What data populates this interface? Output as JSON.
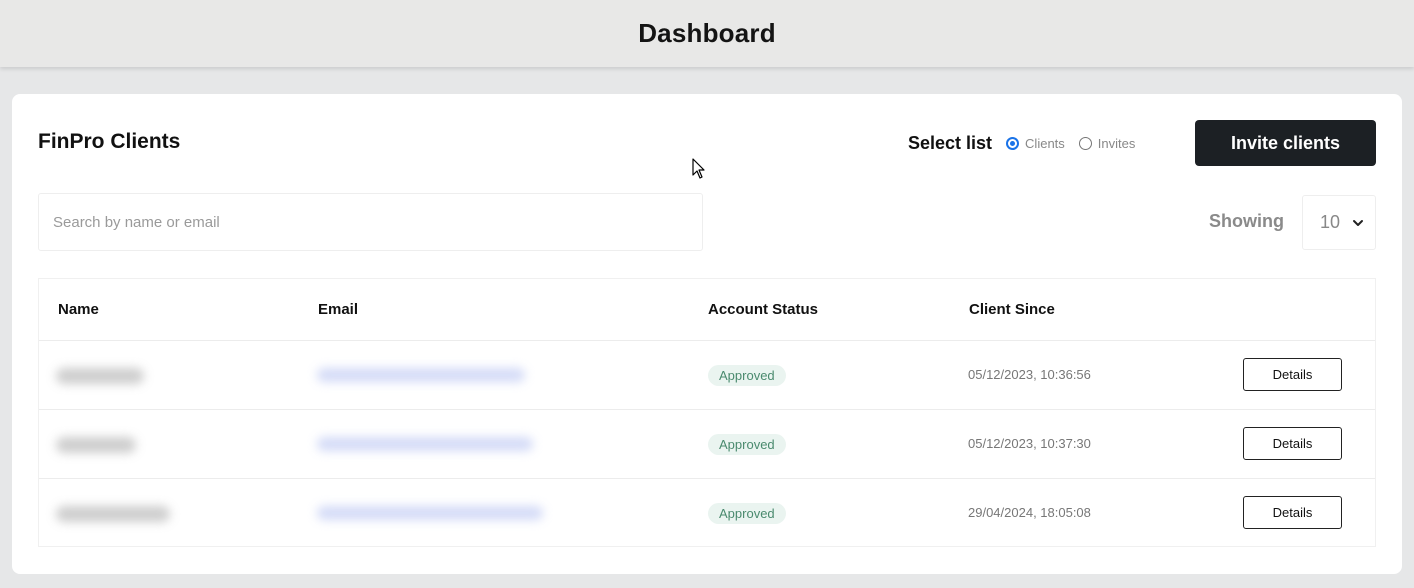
{
  "header": {
    "title": "Dashboard"
  },
  "card": {
    "title": "FinPro Clients",
    "select_list": {
      "label": "Select list",
      "options": [
        {
          "label": "Clients",
          "checked": true
        },
        {
          "label": "Invites",
          "checked": false
        }
      ]
    },
    "invite_button": "Invite clients",
    "search": {
      "placeholder": "Search by name or email",
      "value": ""
    },
    "showing": {
      "label": "Showing",
      "value": "10",
      "icon": "chevron-down-icon"
    }
  },
  "table": {
    "columns": [
      "Name",
      "Email",
      "Account Status",
      "Client Since"
    ],
    "rows": [
      {
        "status": "Approved",
        "client_since": "05/12/2023, 10:36:56",
        "action": "Details"
      },
      {
        "status": "Approved",
        "client_since": "05/12/2023, 10:37:30",
        "action": "Details"
      },
      {
        "status": "Approved",
        "client_since": "29/04/2024, 18:05:08",
        "action": "Details"
      }
    ]
  },
  "colors": {
    "primary_button": "#1c2024",
    "status_bg": "#eaf4f0",
    "status_text": "#4a8a6e",
    "radio_accent": "#1a73e8"
  }
}
